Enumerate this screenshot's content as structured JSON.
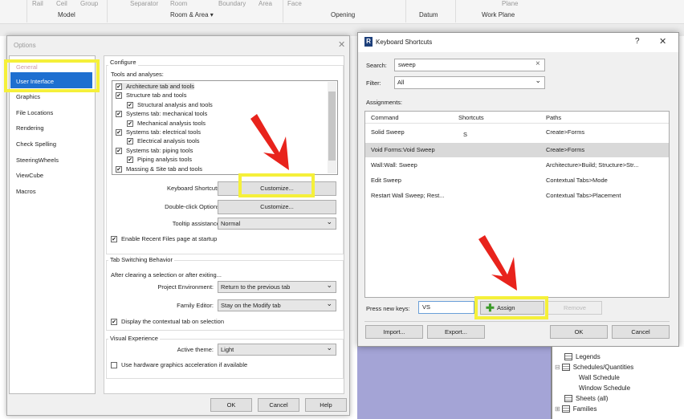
{
  "ribbon": {
    "faded": [
      "Rail",
      "Ceil",
      "Group",
      "Separator",
      "Room",
      "Boundary",
      "Area",
      "Face",
      "Plane"
    ],
    "groups": [
      "Model",
      "Room & Area ▾",
      "Opening",
      "Datum",
      "Work Plane"
    ]
  },
  "options": {
    "title": "Options",
    "close": "✕",
    "nav": [
      "General",
      "User Interface",
      "Graphics",
      "File Locations",
      "Rendering",
      "Check Spelling",
      "SteeringWheels",
      "ViewCube",
      "Macros"
    ],
    "configure": "Configure",
    "tools_label": "Tools and analyses:",
    "tools": [
      {
        "label": "Architecture tab and tools",
        "indent": 0
      },
      {
        "label": "Structure tab and tools",
        "indent": 0
      },
      {
        "label": "Structural analysis and tools",
        "indent": 1
      },
      {
        "label": "Systems tab: mechanical tools",
        "indent": 0
      },
      {
        "label": "Mechanical analysis tools",
        "indent": 1
      },
      {
        "label": "Systems tab: electrical tools",
        "indent": 0
      },
      {
        "label": "Electrical analysis tools",
        "indent": 1
      },
      {
        "label": "Systems tab: piping tools",
        "indent": 0
      },
      {
        "label": "Piping analysis tools",
        "indent": 1
      },
      {
        "label": "Massing & Site tab and tools",
        "indent": 0
      }
    ],
    "check": "✔",
    "kbd_label": "Keyboard Shortcuts:",
    "kbd_btn": "Customize...",
    "dbl_label": "Double-click Options:",
    "dbl_btn": "Customize...",
    "tooltip_label": "Tooltip assistance:",
    "tooltip_value": "Normal",
    "recent_files": "Enable Recent Files page at startup",
    "tab_switch": "Tab Switching Behavior",
    "after_clear": "After clearing a selection or after exiting...",
    "proj_env_label": "Project Environment:",
    "proj_env_value": "Return to the previous tab",
    "fam_label": "Family Editor:",
    "fam_value": "Stay on the Modify tab",
    "contextual": "Display the contextual tab on selection",
    "visual": "Visual Experience",
    "theme_label": "Active theme:",
    "theme_value": "Light",
    "hw": "Use hardware graphics acceleration if available",
    "ok": "OK",
    "cancel": "Cancel",
    "help": "Help"
  },
  "shortcuts": {
    "title": "Keyboard Shortcuts",
    "icon": "R",
    "help": "?",
    "close": "✕",
    "search_label": "Search:",
    "search_value": "sweep",
    "clear": "×",
    "filter_label": "Filter:",
    "filter_value": "All",
    "assignments": "Assignments:",
    "columns": [
      "Command",
      "Shortcuts",
      "Paths"
    ],
    "rows": [
      {
        "command": "Solid Sweep",
        "shortcut": "S",
        "path": "Create>Forms"
      },
      {
        "command": "Void Forms:Void Sweep",
        "shortcut": "",
        "path": "Create>Forms"
      },
      {
        "command": "Wall:Wall: Sweep",
        "shortcut": "",
        "path": "Architecture>Build; Structure>Str..."
      },
      {
        "command": "Edit Sweep",
        "shortcut": "",
        "path": "Contextual Tabs>Mode"
      },
      {
        "command": "Restart Wall Sweep; Rest...",
        "shortcut": "",
        "path": "Contextual Tabs>Placement"
      }
    ],
    "press_label": "Press new keys:",
    "press_value": "VS",
    "assign": "Assign",
    "remove": "Remove",
    "import": "Import...",
    "export": "Export...",
    "ok": "OK",
    "cancel": "Cancel"
  },
  "browser": {
    "items": [
      "Legends",
      "Schedules/Quantities",
      "Wall Schedule",
      "Window Schedule",
      "Sheets (all)",
      "Families"
    ],
    "collapse": "⊟",
    "expand": "⊞"
  },
  "colors": {
    "highlight": "#f5f03a",
    "arrow": "#e8231c",
    "selected": "#1e6fd0"
  }
}
